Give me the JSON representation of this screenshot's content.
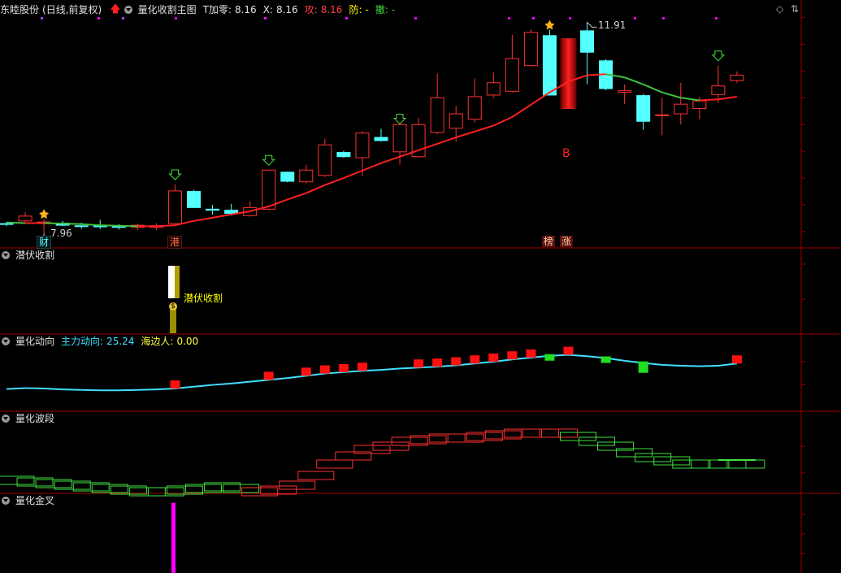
{
  "header": {
    "stock_name": "东睦股份",
    "period": "(日线,前复权)",
    "indicator_name": "量化收割主图",
    "t_label": "T加零:",
    "t_value": "8.16",
    "x_label": "X:",
    "x_value": "8.16",
    "attack_label": "攻:",
    "attack_value": "8.16",
    "defend_label": "防:",
    "defend_value": "-",
    "withdraw_label": "撤:",
    "withdraw_value": "-"
  },
  "panels": {
    "qianfu": {
      "title": "潜伏收割",
      "signal_label": "潜伏收割",
      "coin_label": "$"
    },
    "dongxiang": {
      "title": "量化动向",
      "main_label": "主力动向:",
      "main_value": "25.24",
      "retail_label": "海边人:",
      "retail_value": "0.00"
    },
    "boduan": {
      "title": "量化波段"
    },
    "jincha": {
      "title": "量化金叉"
    }
  },
  "annotations": {
    "low_price": "7.96",
    "high_price": "11.91",
    "buy_mark": "B",
    "tag_cai": "财",
    "tag_gang": "港",
    "tag_bang": "榜",
    "tag_zhang": "涨"
  },
  "axes": {
    "main_ticks": [
      "12.00",
      "11.50",
      "11.00",
      "10.50",
      "10.00",
      "9.50",
      "9.00",
      "8.50",
      "8.00"
    ],
    "qianfu_ticks": [
      "10.00",
      "5.00"
    ],
    "dongxiang_ticks": [
      "35.00",
      "30.00"
    ],
    "boduan_ticks": [
      "75.00",
      "60.00"
    ],
    "jincha_ticks": [
      "7.50",
      "5.00",
      "2.50"
    ]
  },
  "colors": {
    "up": "#ff3232",
    "down": "#54ffff",
    "ma_up": "#ff2020",
    "ma_down": "#40c040",
    "magenta": "#ff00ff",
    "yellow": "#ffff00"
  },
  "chart_data": {
    "type": "candlestick",
    "candles": [
      {
        "o": 8.15,
        "h": 8.18,
        "l": 8.1,
        "c": 8.14
      },
      {
        "o": 8.2,
        "h": 8.36,
        "l": 8.18,
        "c": 8.29
      },
      {
        "o": 8.15,
        "h": 8.24,
        "l": 7.96,
        "c": 8.18
      },
      {
        "o": 8.16,
        "h": 8.2,
        "l": 8.1,
        "c": 8.12
      },
      {
        "o": 8.11,
        "h": 8.17,
        "l": 8.05,
        "c": 8.1
      },
      {
        "o": 8.12,
        "h": 8.22,
        "l": 8.05,
        "c": 8.09
      },
      {
        "o": 8.1,
        "h": 8.14,
        "l": 8.04,
        "c": 8.08
      },
      {
        "o": 8.08,
        "h": 8.15,
        "l": 8.03,
        "c": 8.12
      },
      {
        "o": 8.08,
        "h": 8.16,
        "l": 8.03,
        "c": 8.11
      },
      {
        "o": 8.15,
        "h": 8.88,
        "l": 8.14,
        "c": 8.76
      },
      {
        "o": 8.75,
        "h": 8.78,
        "l": 8.46,
        "c": 8.45
      },
      {
        "o": 8.42,
        "h": 8.5,
        "l": 8.32,
        "c": 8.4
      },
      {
        "o": 8.4,
        "h": 8.52,
        "l": 8.3,
        "c": 8.34
      },
      {
        "o": 8.3,
        "h": 8.57,
        "l": 8.28,
        "c": 8.45
      },
      {
        "o": 8.42,
        "h": 9.15,
        "l": 8.4,
        "c": 9.15
      },
      {
        "o": 9.11,
        "h": 9.12,
        "l": 8.92,
        "c": 8.94
      },
      {
        "o": 8.93,
        "h": 9.25,
        "l": 8.9,
        "c": 9.15
      },
      {
        "o": 9.05,
        "h": 9.74,
        "l": 9.02,
        "c": 9.62
      },
      {
        "o": 9.48,
        "h": 9.51,
        "l": 9.38,
        "c": 9.4
      },
      {
        "o": 9.38,
        "h": 9.88,
        "l": 9.04,
        "c": 9.84
      },
      {
        "o": 9.76,
        "h": 9.92,
        "l": 9.68,
        "c": 9.7
      },
      {
        "o": 9.49,
        "h": 9.92,
        "l": 9.25,
        "c": 10.0
      },
      {
        "o": 9.4,
        "h": 10.12,
        "l": 9.38,
        "c": 10.0
      },
      {
        "o": 9.85,
        "h": 10.95,
        "l": 9.82,
        "c": 10.5
      },
      {
        "o": 9.93,
        "h": 10.35,
        "l": 9.68,
        "c": 10.2
      },
      {
        "o": 10.1,
        "h": 10.86,
        "l": 10.04,
        "c": 10.52
      },
      {
        "o": 10.55,
        "h": 10.97,
        "l": 10.5,
        "c": 10.78
      },
      {
        "o": 10.62,
        "h": 11.67,
        "l": 10.6,
        "c": 11.23
      },
      {
        "o": 11.1,
        "h": 11.78,
        "l": 11.08,
        "c": 11.72
      },
      {
        "o": 11.66,
        "h": 11.77,
        "l": 10.55,
        "c": 10.55
      },
      {
        "o": 10.3,
        "h": 11.6,
        "l": 10.3,
        "c": 11.6
      },
      {
        "o": 11.75,
        "h": 11.91,
        "l": 10.75,
        "c": 11.35
      },
      {
        "o": 11.19,
        "h": 11.22,
        "l": 10.64,
        "c": 10.67
      },
      {
        "o": 10.6,
        "h": 10.75,
        "l": 10.38,
        "c": 10.63
      },
      {
        "o": 10.54,
        "h": 10.57,
        "l": 9.9,
        "c": 10.06
      },
      {
        "o": 10.18,
        "h": 10.5,
        "l": 9.8,
        "c": 10.18
      },
      {
        "o": 10.2,
        "h": 10.78,
        "l": 10.0,
        "c": 10.38
      },
      {
        "o": 10.3,
        "h": 10.52,
        "l": 10.1,
        "c": 10.44
      },
      {
        "o": 10.56,
        "h": 11.1,
        "l": 10.4,
        "c": 10.72
      },
      {
        "o": 10.82,
        "h": 10.99,
        "l": 10.78,
        "c": 10.92
      }
    ],
    "ma": [
      8.17,
      8.16,
      8.16,
      8.15,
      8.14,
      8.12,
      8.11,
      8.1,
      8.1,
      8.12,
      8.2,
      8.26,
      8.32,
      8.38,
      8.47,
      8.6,
      8.72,
      8.87,
      9.0,
      9.14,
      9.28,
      9.4,
      9.52,
      9.64,
      9.76,
      9.87,
      9.98,
      10.14,
      10.37,
      10.6,
      10.8,
      10.92,
      10.94,
      10.88,
      10.75,
      10.6,
      10.5,
      10.45,
      10.47,
      10.52
    ],
    "dongxiang_line": [
      29.0,
      29.2,
      29.1,
      28.9,
      28.8,
      28.7,
      28.7,
      28.8,
      28.9,
      29.1,
      29.5,
      29.9,
      30.2,
      30.6,
      31.0,
      31.4,
      31.9,
      32.4,
      32.7,
      33.0,
      33.2,
      33.5,
      33.7,
      33.9,
      34.2,
      34.6,
      35.0,
      35.5,
      35.9,
      36.3,
      36.5,
      36.2,
      35.8,
      35.2,
      34.7,
      34.3,
      34.1,
      34.0,
      34.1,
      34.6
    ],
    "jincha_value": 9.0
  }
}
